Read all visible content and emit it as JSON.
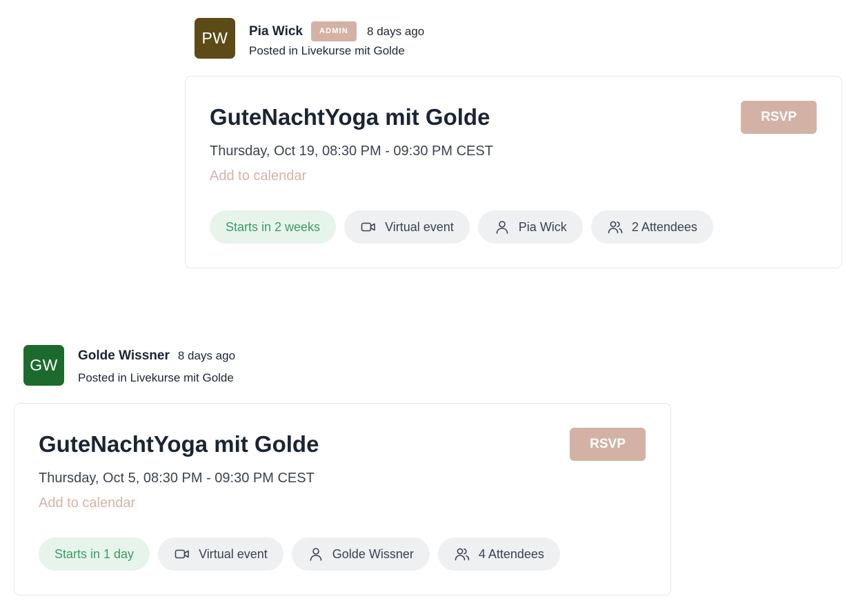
{
  "posts": [
    {
      "author": {
        "initials": "PW",
        "name": "Pia Wick",
        "avatar_color": "#5c4b17",
        "badge": "ADMIN"
      },
      "time_ago": "8 days ago",
      "posted_in": "Posted in Livekurse mit Golde",
      "event": {
        "title": "GuteNachtYoga mit Golde",
        "datetime": "Thursday, Oct 19, 08:30 PM - 09:30 PM CEST",
        "add_to_calendar": "Add to calendar",
        "rsvp_label": "RSVP",
        "starts_in": "Starts in 2 weeks",
        "location_type": "Virtual event",
        "host": "Pia Wick",
        "attendees": "2 Attendees"
      }
    },
    {
      "author": {
        "initials": "GW",
        "name": "Golde Wissner",
        "avatar_color": "#1d6a2e"
      },
      "time_ago": "8 days ago",
      "posted_in": "Posted in Livekurse mit Golde",
      "event": {
        "title": "GuteNachtYoga mit Golde",
        "datetime": "Thursday, Oct 5, 08:30 PM - 09:30 PM CEST",
        "add_to_calendar": "Add to calendar",
        "rsvp_label": "RSVP",
        "starts_in": "Starts in 1 day",
        "location_type": "Virtual event",
        "host": "Golde Wissner",
        "attendees": "4 Attendees"
      }
    }
  ],
  "icons": {
    "location": "video-camera-icon",
    "host": "user-icon",
    "attendees": "users-icon"
  },
  "colors": {
    "accent": "#d3b2a5",
    "text": "#1c2433",
    "starts_green": "#3e9a62",
    "starts_bg": "#e7f4ec",
    "pill_bg": "#eef0f2"
  }
}
